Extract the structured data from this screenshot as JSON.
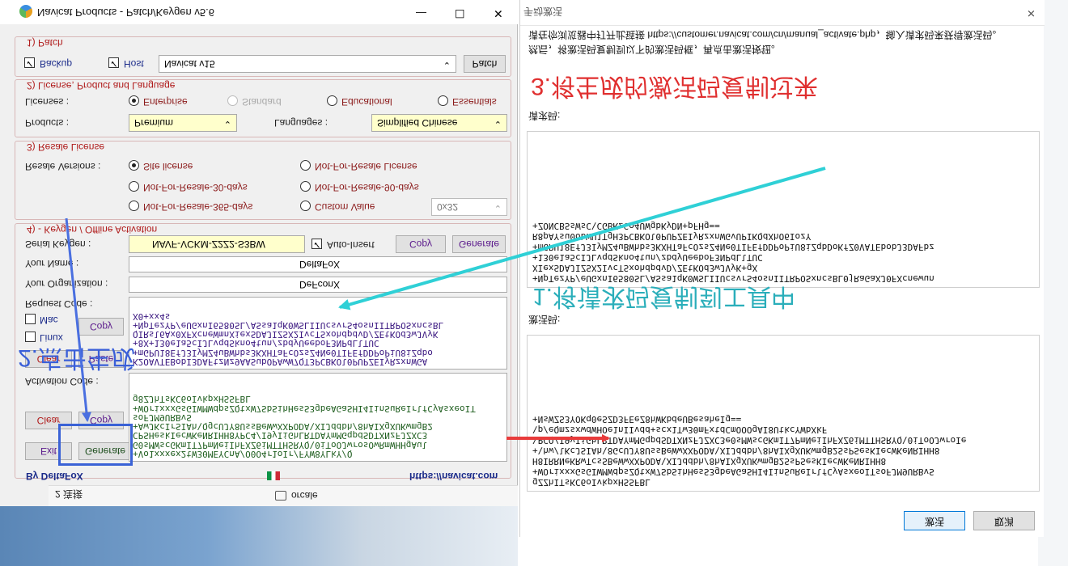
{
  "window": {
    "title": "Navicat Products - Patch/Keygen v5.6",
    "minimize": "—",
    "maximize": "☐",
    "close": "✕",
    "by_label": "By DeltaFoX",
    "url": "https://navicat.com",
    "tab_left": "2 连接",
    "tab_right": "orcale"
  },
  "patch": {
    "legend": "1) Patch",
    "backup_label": "Backup",
    "host_label": "Host",
    "product_selected": "Navicat v15",
    "patch_button": "Patch"
  },
  "license": {
    "legend": "2) License, Product and Language",
    "licenses_label": "Licenses :",
    "options": [
      "Enterprise",
      "Standard",
      "Educational",
      "Essentials"
    ],
    "selected": "Enterprise",
    "products_label": "Products :",
    "products_value": "Premium",
    "languages_label": "Languages :",
    "languages_value": "Simplified Chinese"
  },
  "resale": {
    "legend": "3) Resale License",
    "versions_label": "Resale Versions :",
    "options": [
      "Site license",
      "Not-For-Resale License",
      "Not-For-Resale-30-days",
      "Not-For-Resale-90-days",
      "Not-For-Resale-365-days",
      "Custom Value"
    ],
    "selected": "Site license",
    "custom_value": "0x32"
  },
  "keygen": {
    "legend": "4) - Keygen / Offline Activation",
    "serial_label": "Serial Keygen :",
    "serial_value": "NAVF-VCKM-Z2Z2-S3BW",
    "auto_insert": "Auto-Insert",
    "copy": "Copy",
    "generate": "Generate",
    "name_label": "Your Name :",
    "name_value": "DeltaFoX",
    "org_label": "Your Organization :",
    "org_value": "DeFconX",
    "request_label": "Request Code :",
    "mac_label": "Mac",
    "linux_label": "Linux",
    "clear": "Clear",
    "paste": "Paste",
    "activation_label": "Activation Code :",
    "exit": "Exit",
    "request_text": "K2OAVTEBobI3DAFtzNz9AASubOPAwW7QT3PCBKOl0PUPZEIyRzxnWGA\n+mGPU18EfJ3IyMZ4uBWhbs3KXHTaFcOzsZ4Ne0TIFEfDDPoPiU8iZqbo\n+8X+130e1a5cIJLvqdSkno4tun/zbdyUeeboF3NPdLlTUC\nQIRsl6Ax0XFXcneWmnXiexSDAJIZSX2IvcTSxohdpdvD/ZEtKOd3wJVyK\n+NpTezYP/eUGxnI6580SL/ASsa1qK0WSLIIUcsvrS4osnIITRPOSxncsBL\nX0+xx4s",
    "activation_text": "+Vo1xxxex2tW30MEYCnA/O0O4r1oIr/FYW8YLkY/Q\nG0sMWscGKmIT7PmNeiIhFXZ6iMTTHSRYQ\\0iToOJwrosOwRmWHHgAul\nCPSHeskIecWKeNRIHH8YPC4/I9yIiGhLRTDAYmMGqpdSDTXNzFJZXC3\n+AwJKcIrSIAh\\QgcUJY8UssBeWwXXPODA\\XIJddbh/8hAIXgXUKwmgB2\nsoFJM9URBvS\n+WOrixxxGsGIWMWdpsZQtxW7SbSihHesS3gbeAGaSHI4IinSuReIrlfCyAsxeoIT\ng8ZJhTsKC6oIvkpxHSSFBL"
  },
  "dialog": {
    "title": "手动激活",
    "close": "✕",
    "instruction": "请在你浏览器中打开此链接 https://customer.navicat.com/cn/manual_activate.php，输入请求码来获得激活码。",
    "instruction2": "然后，将激活码复制到以下的激活码框，再点击激活按钮。",
    "request_label": "请求码:",
    "activation_label": "激活码:",
    "request_text": "+NpTezYP/eUGxnI6580SL/ASsa1qK0WSLIIUcsvrS4osnIITRPOSxncsBL0jRaGaXJ0FXcnewun\nXIexSDAJIZSX2IvcTSxohdpdvD/ZEtKOd3wJVyK+gX\n+130e1a5cIJLvqdSkno4tun/zbdyUeeboF3NPdLlTUC\n+mGPU18EfJ3IyMZ4uBWhbs3KXHTaFcOzsZ4Ne0TIFEfDDPoPiU8iZqbDoKfZ0VATEbobJ3DAFbz\nR8pAYsu0obWU1TgH3PCBKOl0PUPZEIyRzxnWGvUPIKQdXhO6IozY\n+ZONCBSsWsC\\CGBKzGo4UWgbKyDN+pFHg==",
    "activation_text": "gZZhITsKC6oIvkpxHSSFBL\n+WOrixxxGsGIWMWdpsZQtxW7SbSihHesS3gbeAGaSHI4IinSuReIrlfCyAsxeoITsoFJM9URBvS\nH8IRRNeKRwTcsSBeWwXXPODA\\XIJddbh/8hAIXgXUKwmgB2SsPSesKIecWKeNRIHH8\n+\\hw/lKcJSIAh\\8GcUJY8UssBeWwXXPODA\\XIJddbh/8hAIXgXUKwmgB2SsPSesKIecWKeNRIHH8\n\\PCQ/I9yIiGhLRTDAYmMGqpdSDTXNzFJZXC3e0sMWscGKmIT7PmNeiIhFXZ6iMTTHSRYQ\\0iToOJwroIe\n\\p/eQmzsxwdWHOe1nIIvdd+scx1Tw30mFxtdCmOOOgAI8UtkcYWbXkF\n+NsWZS3YOKq0eSZD3FEeZ8hWKbdeUBesaheIg=="
  },
  "buttons": {
    "activate": "激活",
    "cancel": "取消"
  },
  "annotations": {
    "step1": "1.将请求码复制到工具中",
    "step2": "2.点击生成",
    "step3": "3.将生成的激活码复制过来"
  },
  "colors": {
    "red_arrow": "#e83b3b",
    "blue_arrow": "#4a6fe0",
    "cyan_arrow": "#2fd0d6",
    "highlight_box": "#3a62d6"
  }
}
